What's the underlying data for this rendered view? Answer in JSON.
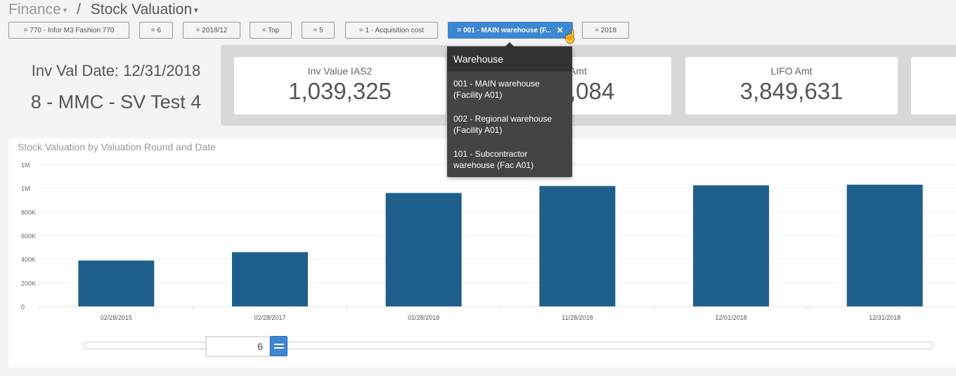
{
  "breadcrumb": {
    "parent": "Finance",
    "current": "Stock Valuation"
  },
  "filters": [
    {
      "label": "= 770 - Infor M3 Fashion 770"
    },
    {
      "label": "= 6"
    },
    {
      "label": "= 2018/12"
    },
    {
      "label": "= Top"
    },
    {
      "label": "= 5"
    },
    {
      "label": "= 1 - Acquisition cost"
    },
    {
      "label": "= 001 - MAIN warehouse (F...",
      "active": true,
      "close": "✕"
    },
    {
      "label": "= 2018"
    }
  ],
  "info": {
    "date": "Inv Val Date: 12/31/2018",
    "name": "8 - MMC - SV Test 4"
  },
  "kpis": [
    {
      "label": "Inv Value IAS2",
      "value": "1,039,325"
    },
    {
      "label": "Amt",
      "value": ",084"
    },
    {
      "label": "LIFO Amt",
      "value": "3,849,631"
    },
    {
      "label": "",
      "value": ""
    }
  ],
  "dropdown": {
    "title": "Warehouse",
    "items": [
      "001 - MAIN warehouse (Facility A01)",
      "002 - Regional warehouse (Facility A01)",
      "101 - Subcontractor warehouse (Fac A01)"
    ]
  },
  "slider": {
    "value": "6"
  },
  "colors": {
    "bar": "#1f5f8b",
    "accent": "#3d86d0",
    "dropdown": "#444444"
  },
  "chart_data": {
    "type": "bar",
    "title": "Stock Valuation by Valuation Round and Date",
    "categories": [
      "02/28/2015",
      "02/28/2017",
      "02/28/2018",
      "11/28/2018",
      "12/01/2018",
      "12/31/2018"
    ],
    "values": [
      388000,
      459000,
      959000,
      1018000,
      1024000,
      1029000
    ],
    "yticks": [
      {
        "v": 0,
        "label": "0"
      },
      {
        "v": 200000,
        "label": "200K"
      },
      {
        "v": 400000,
        "label": "400K"
      },
      {
        "v": 600000,
        "label": "600K"
      },
      {
        "v": 800000,
        "label": "800K"
      },
      {
        "v": 1000000,
        "label": "1M"
      },
      {
        "v": 1200000,
        "label": "1M"
      }
    ],
    "ylim": [
      0,
      1200000
    ],
    "grid": true
  }
}
